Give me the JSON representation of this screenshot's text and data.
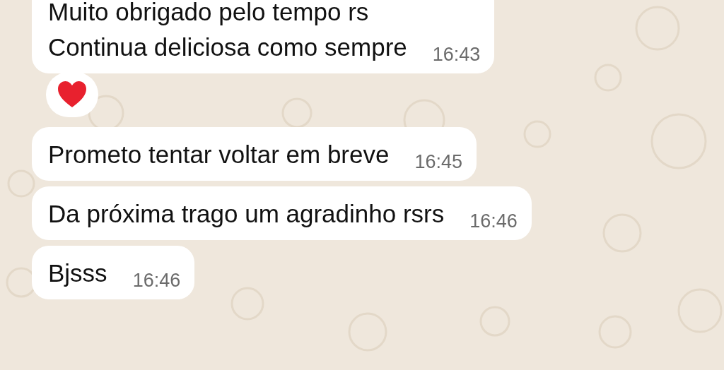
{
  "messages": [
    {
      "text": "Muito obrigado pelo tempo rs\nContinua deliciosa como sempre",
      "time": "16:43",
      "reaction": {
        "kind": "heart"
      }
    },
    {
      "text": "Prometo tentar voltar em breve",
      "time": "16:45"
    },
    {
      "text": "Da próxima trago um agradinho rsrs",
      "time": "16:46"
    },
    {
      "text": "Bjsss",
      "time": "16:46"
    }
  ]
}
